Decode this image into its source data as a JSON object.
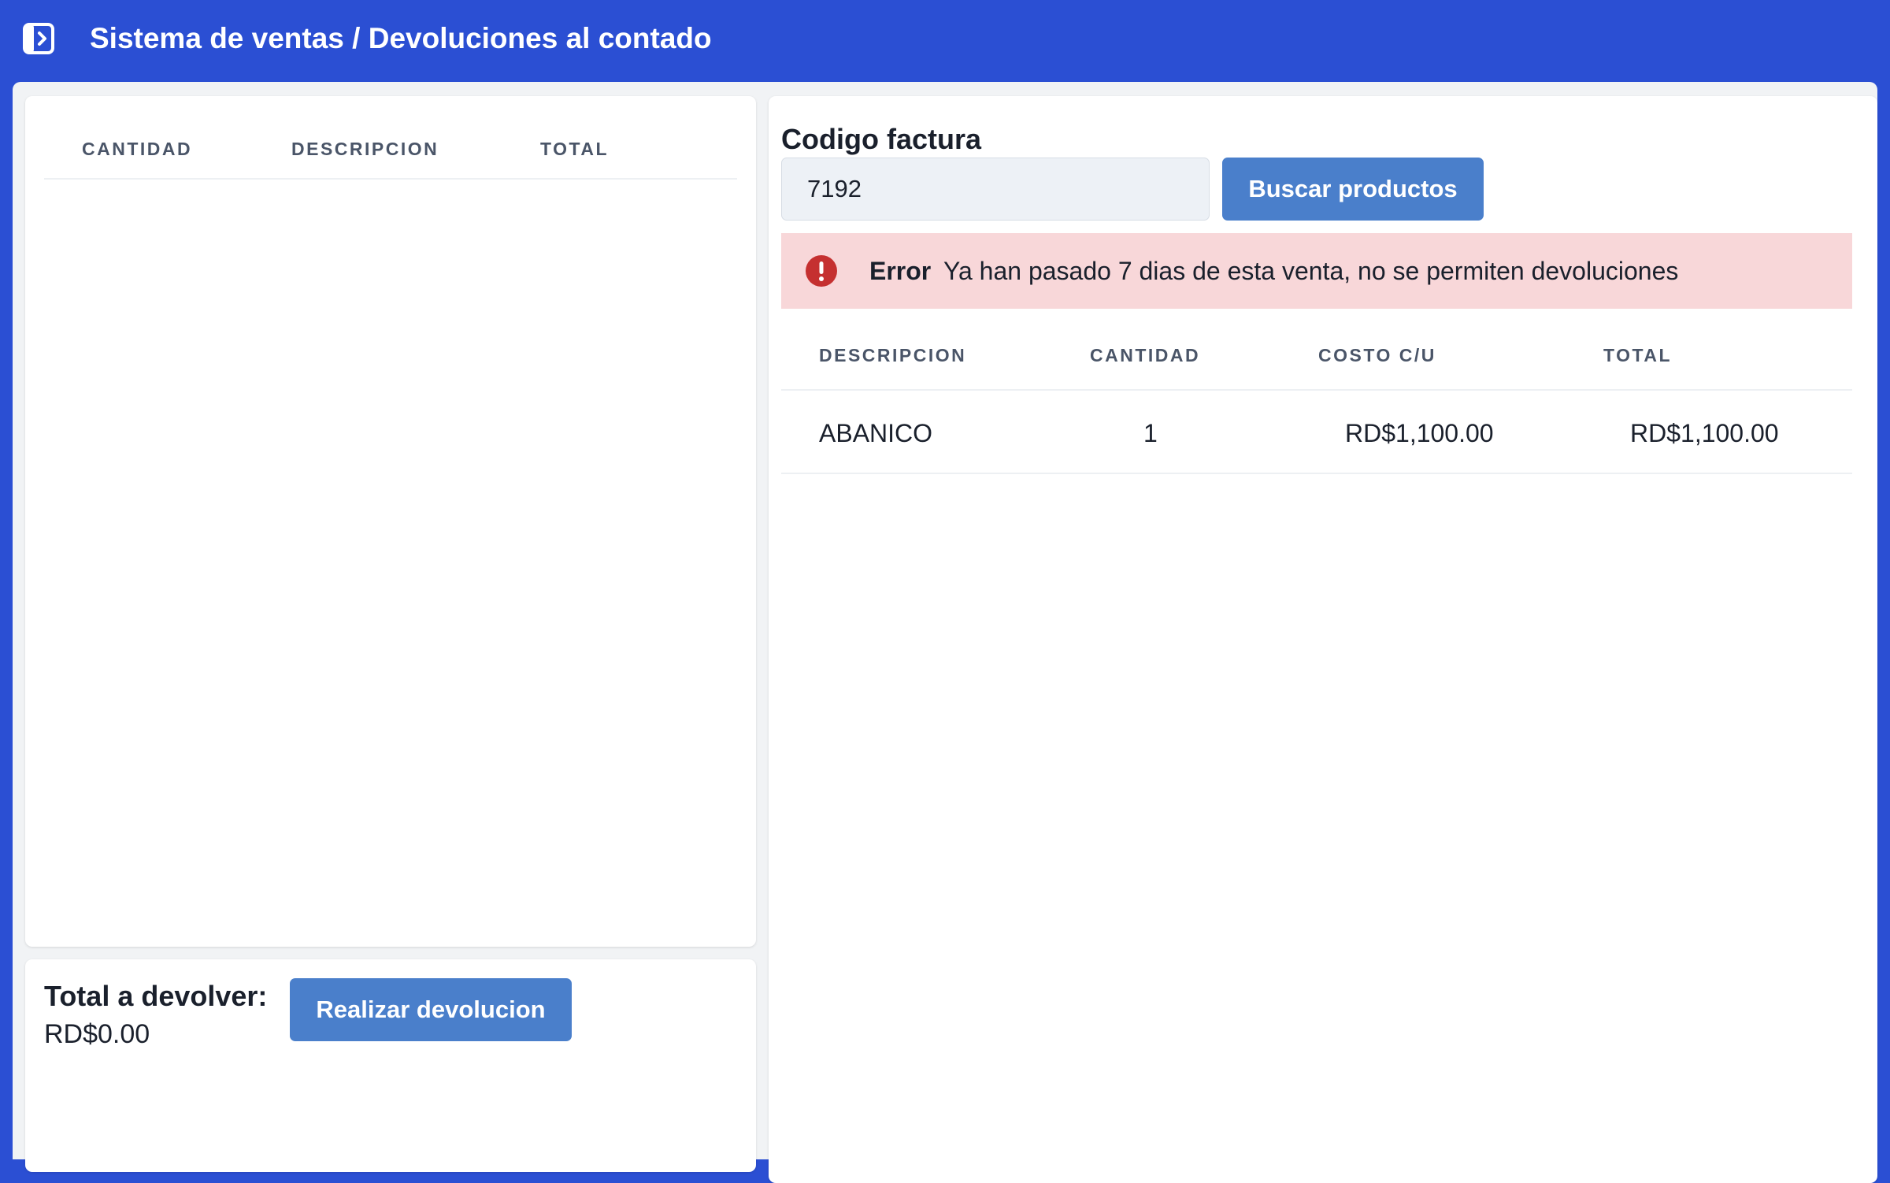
{
  "header": {
    "title": "Sistema de ventas / Devoluciones al contado",
    "toggle_icon": "sidebar-toggle-icon",
    "background_color": "#2b4fd3"
  },
  "returns_table": {
    "columns": [
      "CANTIDAD",
      "DESCRIPCION",
      "TOTAL"
    ],
    "rows": []
  },
  "summary": {
    "total_label": "Total a devolver:",
    "total_value": "RD$0.00",
    "action_label": "Realizar devolucion"
  },
  "invoice": {
    "code_label": "Codigo factura",
    "code_value": "7192",
    "search_label": "Buscar productos",
    "button_color": "#4a7fcb"
  },
  "alert": {
    "icon": "error-circle-icon",
    "title": "Error",
    "message": "Ya han pasado 7 dias de esta venta, no se permiten devoluciones",
    "background_color": "#f8d7d9",
    "icon_color": "#c53030"
  },
  "invoice_table": {
    "columns": [
      "DESCRIPCION",
      "CANTIDAD",
      "COSTO C/U",
      "TOTAL"
    ],
    "rows": [
      {
        "descripcion": "ABANICO",
        "cantidad": "1",
        "costo": "RD$1,100.00",
        "total": "RD$1,100.00"
      }
    ]
  }
}
